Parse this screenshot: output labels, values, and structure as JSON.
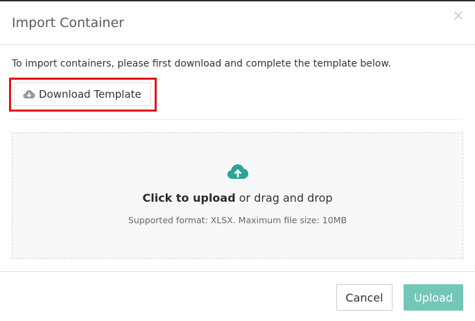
{
  "modal": {
    "title": "Import Container",
    "close_symbol": "×"
  },
  "body": {
    "intro_text": "To import containers, please first download and complete the template below.",
    "download_button": {
      "label": "Download Template",
      "icon": "cloud-download-icon",
      "highlighted": true
    },
    "dropzone": {
      "icon": "cloud-upload-icon",
      "upload_link": "Click to upload",
      "upload_suffix": " or drag and drop",
      "supported_text": "Supported format: XLSX. Maximum file size: 10MB"
    }
  },
  "footer": {
    "cancel_label": "Cancel",
    "upload_label": "Upload"
  },
  "colors": {
    "accent": "#73c7b8",
    "icon_teal": "#2aa597",
    "highlight_red": "#e01515",
    "icon_gray": "#9a9a9a"
  }
}
